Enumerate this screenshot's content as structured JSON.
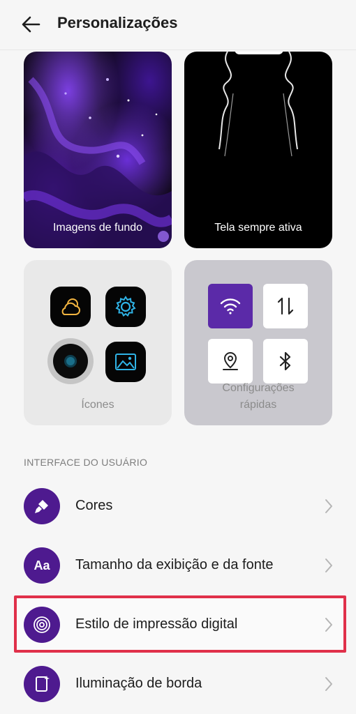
{
  "header": {
    "title": "Personalizações"
  },
  "cards": {
    "wallpaper_label": "Imagens de fundo",
    "aod_label": "Tela sempre ativa",
    "icons_label": "Ícones",
    "quick_label_line1": "Configurações",
    "quick_label_line2": "rápidas"
  },
  "section": {
    "title": "INTERFACE DO USUÁRIO"
  },
  "list": [
    {
      "label": "Cores",
      "icon": "paint-roller-icon"
    },
    {
      "label": "Tamanho da exibição e da fonte",
      "icon": "font-size-icon",
      "icon_text": "Aa"
    },
    {
      "label": "Estilo de impressão digital",
      "icon": "fingerprint-icon"
    },
    {
      "label": "Iluminação de borda",
      "icon": "edge-light-icon"
    }
  ],
  "colors": {
    "accent": "#4e1a8f",
    "highlight": "#e0304a",
    "active_tile": "#5b2aa8"
  }
}
